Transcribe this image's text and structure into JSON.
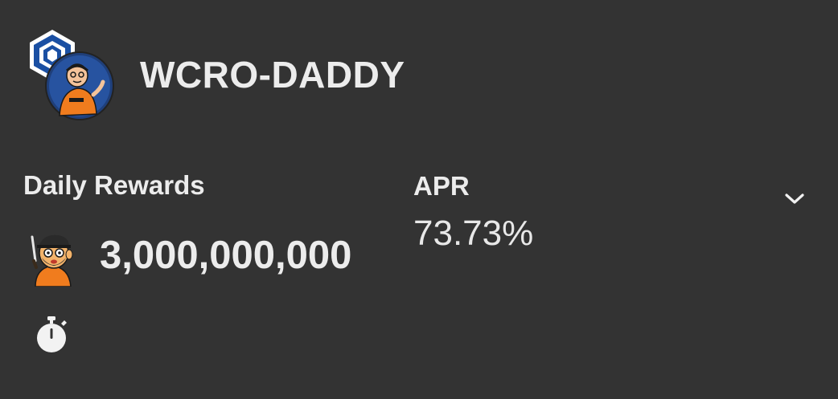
{
  "pool": {
    "title": "WCRO-DADDY",
    "token_a_icon": "cronos-logo-icon",
    "token_b_icon": "daddy-token-icon"
  },
  "rewards": {
    "label": "Daily Rewards",
    "amount": "3,000,000,000",
    "token_icon": "daddy-mascot-icon",
    "timer_icon": "stopwatch-icon"
  },
  "apr": {
    "label": "APR",
    "value": "73.73%"
  },
  "expand": {
    "icon": "chevron-down-icon"
  },
  "colors": {
    "background": "#333333",
    "text": "#ececec",
    "cronos_blue": "#1a4fa3",
    "daddy_orange": "#f07c1e"
  }
}
